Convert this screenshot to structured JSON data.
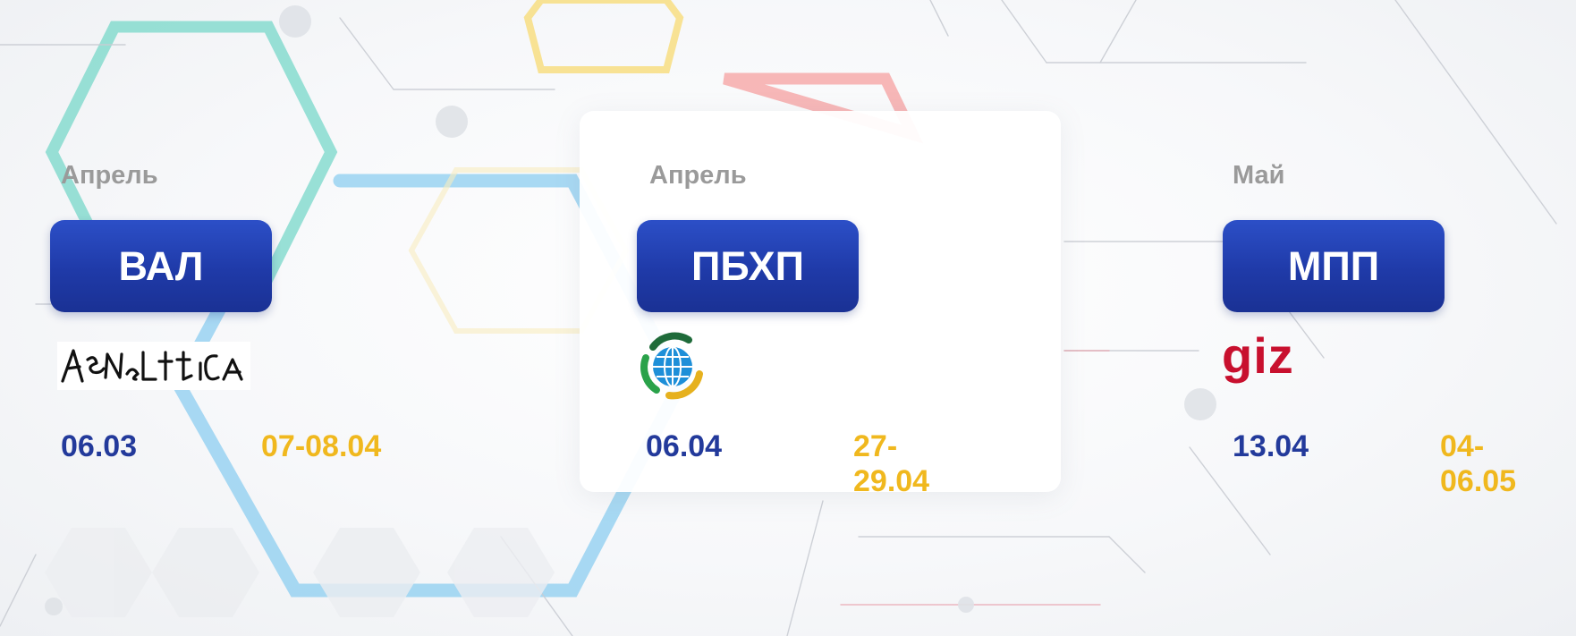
{
  "events": [
    {
      "month": "Апрель",
      "badge": "ВАЛ",
      "logo": "analitica-logo",
      "start_date": "06.03",
      "end_date": "07-08.04"
    },
    {
      "month": "Апрель",
      "badge": "ПБХП",
      "logo": "globe-logo",
      "start_date": "06.04",
      "end_date": "27-29.04"
    },
    {
      "month": "Май",
      "badge": "МПП",
      "logo": "giz-logo",
      "logo_text": "giz",
      "start_date": "13.04",
      "end_date": "04-06.05"
    }
  ],
  "colors": {
    "badge": "#1f3aa8",
    "start_date": "#233a9b",
    "end_date": "#f0b81e",
    "month": "#9a9a9a",
    "giz_red": "#c8102e"
  }
}
